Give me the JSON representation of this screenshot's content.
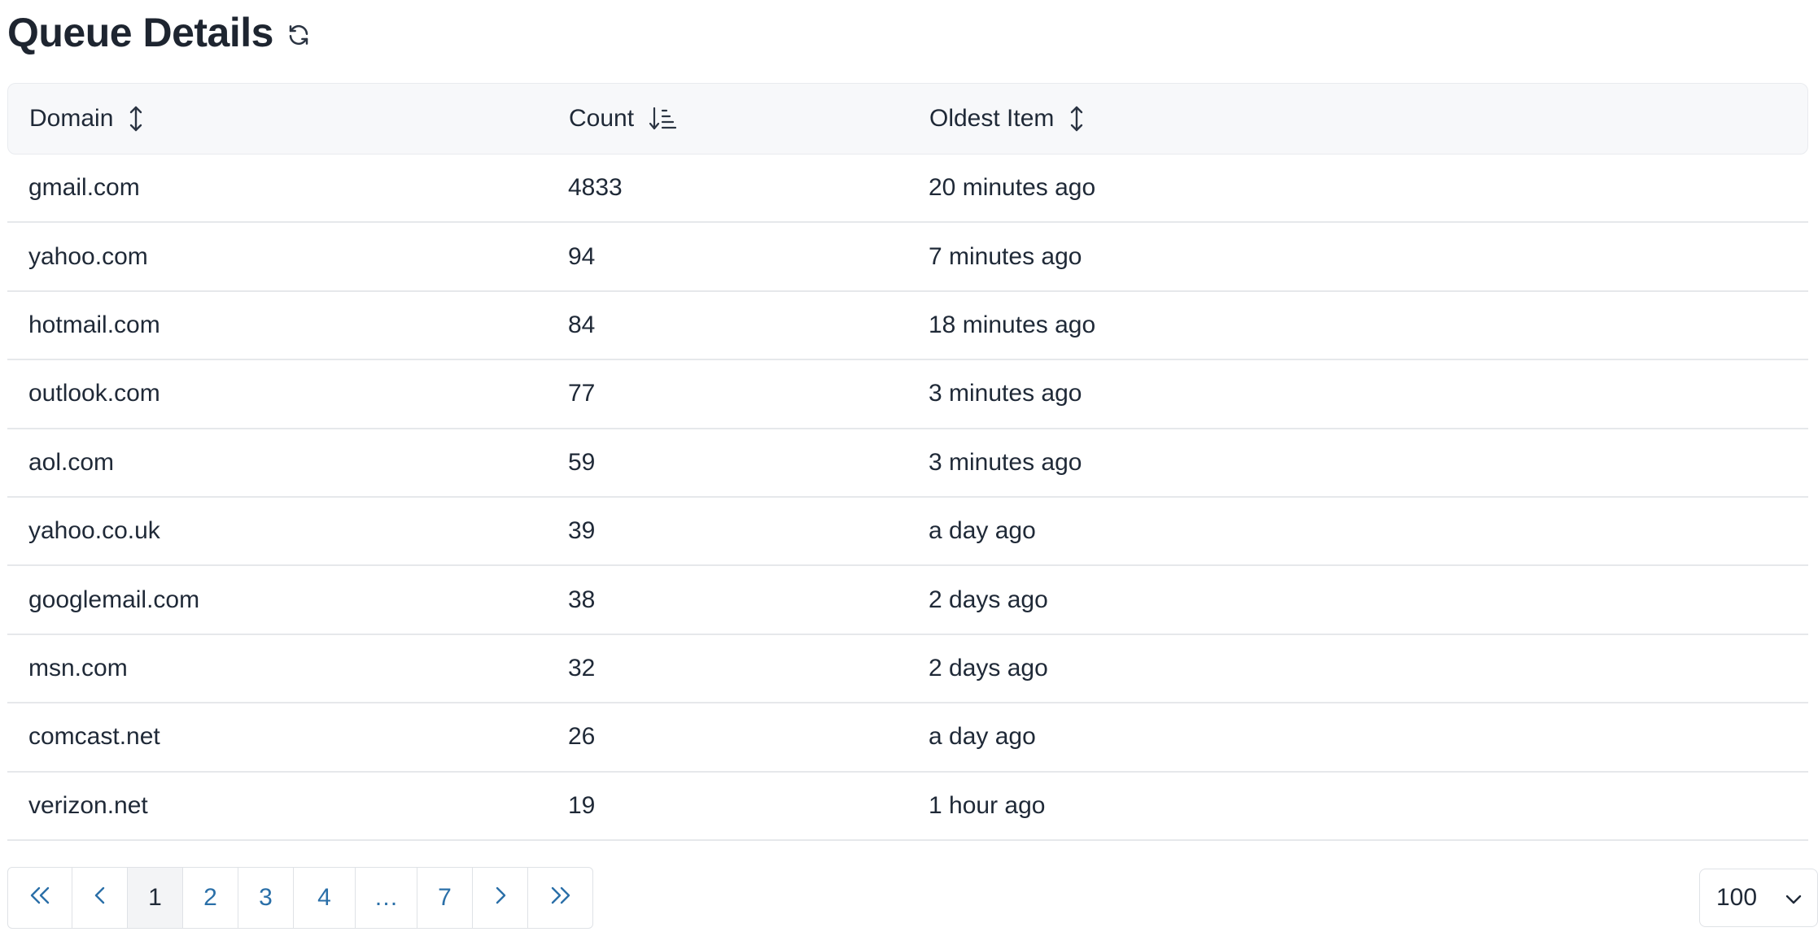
{
  "header": {
    "title": "Queue Details",
    "refresh_icon": "refresh-icon"
  },
  "table": {
    "columns": [
      {
        "label": "Domain",
        "sort_icon": "sort-both-icon"
      },
      {
        "label": "Count",
        "sort_icon": "sort-descending-icon"
      },
      {
        "label": "Oldest Item",
        "sort_icon": "sort-both-icon"
      }
    ],
    "rows": [
      {
        "domain": "gmail.com",
        "count": "4833",
        "oldest": "20 minutes ago"
      },
      {
        "domain": "yahoo.com",
        "count": "94",
        "oldest": "7 minutes ago"
      },
      {
        "domain": "hotmail.com",
        "count": "84",
        "oldest": "18 minutes ago"
      },
      {
        "domain": "outlook.com",
        "count": "77",
        "oldest": "3 minutes ago"
      },
      {
        "domain": "aol.com",
        "count": "59",
        "oldest": "3 minutes ago"
      },
      {
        "domain": "yahoo.co.uk",
        "count": "39",
        "oldest": "a day ago"
      },
      {
        "domain": "googlemail.com",
        "count": "38",
        "oldest": "2 days ago"
      },
      {
        "domain": "msn.com",
        "count": "32",
        "oldest": "2 days ago"
      },
      {
        "domain": "comcast.net",
        "count": "26",
        "oldest": "a day ago"
      },
      {
        "domain": "verizon.net",
        "count": "19",
        "oldest": "1 hour ago"
      }
    ]
  },
  "pagination": {
    "pages": [
      "1",
      "2",
      "3",
      "4",
      "…",
      "7"
    ],
    "current_page": "1",
    "icons": {
      "first": "double-chevron-left-icon",
      "prev": "chevron-left-icon",
      "next": "chevron-right-icon",
      "last": "double-chevron-right-icon"
    }
  },
  "page_size": {
    "value": "100",
    "icon": "chevron-down-icon"
  },
  "colors": {
    "link": "#2a6fa8",
    "header_bg": "#f7f8fa",
    "border": "#e6e8eb",
    "text": "#1f2937"
  }
}
